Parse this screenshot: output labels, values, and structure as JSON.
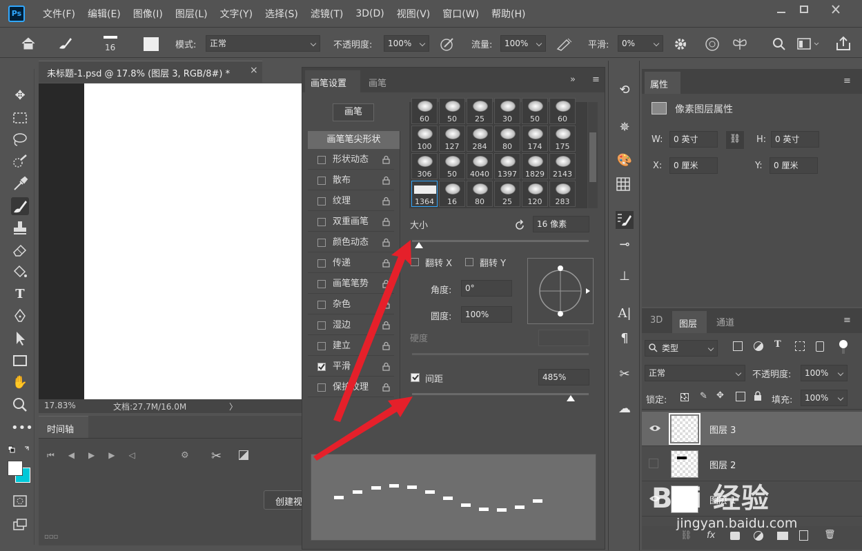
{
  "app": {
    "logo": "Ps"
  },
  "menu": [
    "文件(F)",
    "编辑(E)",
    "图像(I)",
    "图层(L)",
    "文字(Y)",
    "选择(S)",
    "滤镜(T)",
    "3D(D)",
    "视图(V)",
    "窗口(W)",
    "帮助(H)"
  ],
  "options": {
    "brush_size": "16",
    "mode_label": "模式:",
    "mode_value": "正常",
    "opacity_label": "不透明度:",
    "opacity_value": "100%",
    "flow_label": "流量:",
    "flow_value": "100%",
    "smooth_label": "平滑:",
    "smooth_value": "0%"
  },
  "document": {
    "tab_title": "未标题-1.psd @ 17.8% (图层 3, RGB/8#) *",
    "zoom": "17.83%",
    "doc_info": "文档:27.7M/16.0M"
  },
  "timeline": {
    "tab": "时间轴",
    "create_button": "创建视"
  },
  "brush_panel": {
    "tabs": [
      "画笔设置",
      "画笔"
    ],
    "brushes_button": "画笔",
    "tip_shape": "画笔笔尖形状",
    "options": [
      {
        "label": "形状动态",
        "checked": false
      },
      {
        "label": "散布",
        "checked": false
      },
      {
        "label": "纹理",
        "checked": false
      },
      {
        "label": "双重画笔",
        "checked": false
      },
      {
        "label": "颜色动态",
        "checked": false
      },
      {
        "label": "传递",
        "checked": false
      },
      {
        "label": "画笔笔势",
        "checked": false
      },
      {
        "label": "杂色",
        "checked": false
      },
      {
        "label": "湿边",
        "checked": false
      },
      {
        "label": "建立",
        "checked": false
      },
      {
        "label": "平滑",
        "checked": true
      },
      {
        "label": "保护纹理",
        "checked": false
      }
    ],
    "presets": [
      "60",
      "50",
      "25",
      "30",
      "50",
      "60",
      "100",
      "127",
      "284",
      "80",
      "174",
      "175",
      "306",
      "50",
      "4040",
      "1397",
      "1829",
      "2143",
      "1364",
      "16",
      "80",
      "25",
      "120",
      "283"
    ],
    "size_label": "大小",
    "size_value": "16 像素",
    "size_fraction": 0.04,
    "flip_x": "翻转 X",
    "flip_y": "翻转 Y",
    "angle_label": "角度:",
    "angle_value": "0°",
    "roundness_label": "圆度:",
    "roundness_value": "100%",
    "hardness_label": "硬度",
    "spacing_label": "间距",
    "spacing_value": "485%",
    "spacing_checked": true,
    "spacing_fraction": 0.9
  },
  "properties": {
    "tab": "属性",
    "title": "像素图层属性",
    "w_label": "W:",
    "w_value": "0 英寸",
    "h_label": "H:",
    "h_value": "0 英寸",
    "x_label": "X:",
    "x_value": "0 厘米",
    "y_label": "Y:",
    "y_value": "0 厘米"
  },
  "layers_panel": {
    "tabs": [
      "3D",
      "图层",
      "通道"
    ],
    "filter_label": "类型",
    "blend_mode": "正常",
    "opacity_label": "不透明度:",
    "opacity_value": "100%",
    "lock_label": "锁定:",
    "fill_label": "填充:",
    "fill_value": "100%",
    "layers": [
      {
        "name": "图层 3",
        "visible": true,
        "selected": true
      },
      {
        "name": "图层 2",
        "visible": false,
        "selected": false
      },
      {
        "name": "图层 1",
        "visible": true,
        "selected": false
      }
    ]
  },
  "watermark": {
    "brand": "Bai 经验",
    "url": "jingyan.baidu.com"
  },
  "colors": {
    "accent_arrow": "#e5202a",
    "selection": "#31a8ff",
    "background_color_swatch": "#00c8d8"
  }
}
